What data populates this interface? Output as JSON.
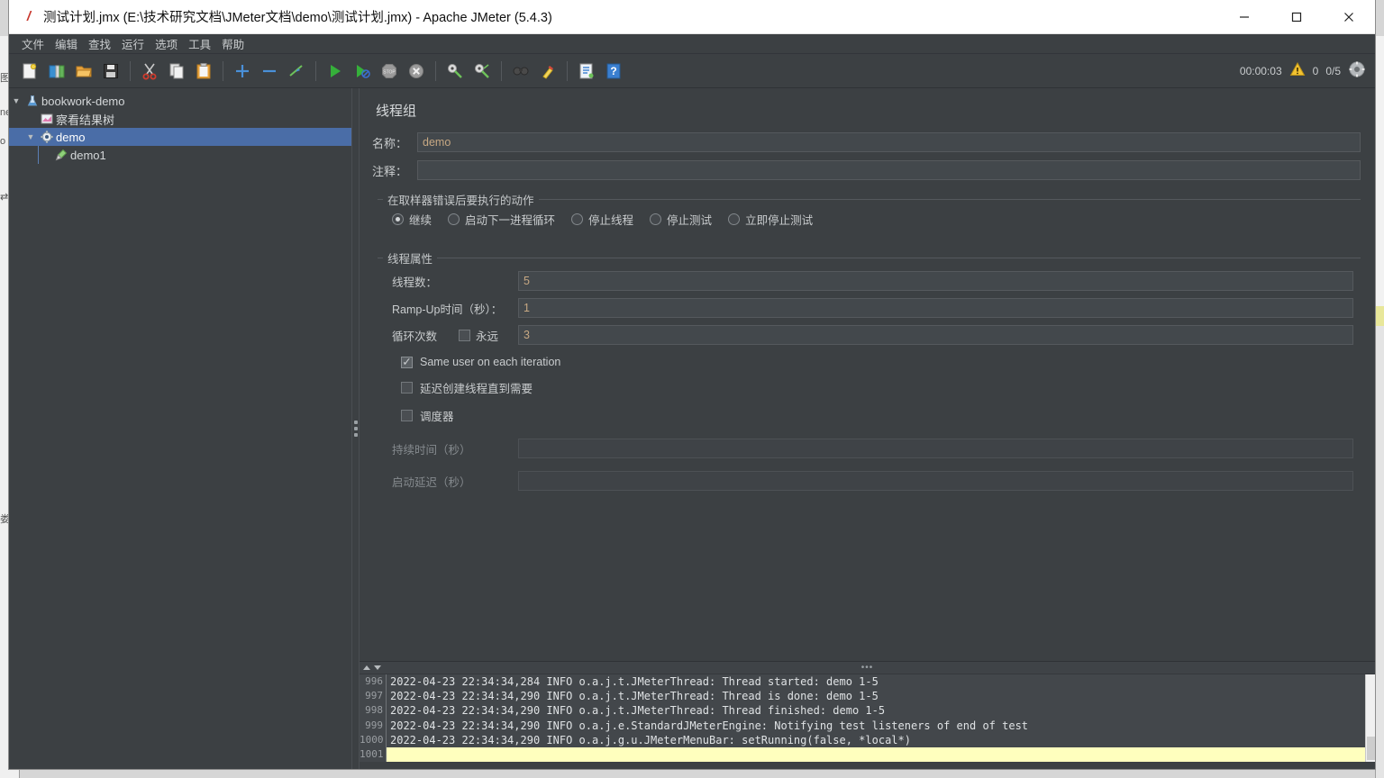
{
  "window": {
    "title": "测试计划.jmx (E:\\技术研究文档\\JMeter文档\\demo\\测试计划.jmx) - Apache JMeter (5.4.3)",
    "app_icon": "jmeter-feather-icon",
    "minimize_label": "—",
    "maximize_label": "□",
    "close_label": "✕"
  },
  "menubar": {
    "items": [
      {
        "label": "文件",
        "name": "menu-file"
      },
      {
        "label": "编辑",
        "name": "menu-edit"
      },
      {
        "label": "查找",
        "name": "menu-search"
      },
      {
        "label": "运行",
        "name": "menu-run"
      },
      {
        "label": "选项",
        "name": "menu-options"
      },
      {
        "label": "工具",
        "name": "menu-tools"
      },
      {
        "label": "帮助",
        "name": "menu-help"
      }
    ]
  },
  "toolbar": {
    "buttons": [
      {
        "name": "new-icon",
        "glyph": "📄"
      },
      {
        "name": "templates-icon",
        "glyph": "📚"
      },
      {
        "name": "open-icon",
        "glyph": "📂"
      },
      {
        "name": "save-icon",
        "glyph": "💾"
      },
      {
        "name": "cut-icon",
        "glyph": "✂"
      },
      {
        "name": "copy-icon",
        "glyph": "📑"
      },
      {
        "name": "paste-icon",
        "glyph": "📋"
      },
      {
        "name": "expand-all-icon",
        "glyph": "+"
      },
      {
        "name": "collapse-all-icon",
        "glyph": "−"
      },
      {
        "name": "toggle-icon",
        "glyph": "⚡"
      },
      {
        "name": "start-icon",
        "glyph": "▶"
      },
      {
        "name": "start-no-pauses-icon",
        "glyph": "▶"
      },
      {
        "name": "stop-icon",
        "glyph": "STOP"
      },
      {
        "name": "shutdown-icon",
        "glyph": "✖"
      },
      {
        "name": "clear-icon",
        "glyph": "🧹"
      },
      {
        "name": "clear-all-icon",
        "glyph": "🧹"
      },
      {
        "name": "search-icon",
        "glyph": "🔍"
      },
      {
        "name": "reset-search-icon",
        "glyph": "🧹"
      },
      {
        "name": "function-helper-icon",
        "glyph": "📝"
      },
      {
        "name": "help-icon",
        "glyph": "?"
      }
    ],
    "status": {
      "elapsed": "00:00:03",
      "warning_icon": "warning-triangle-icon",
      "warning_count": "0",
      "threads": "0/5",
      "activity_icon": "activity-indicator-icon"
    }
  },
  "tree": {
    "nodes": [
      {
        "label": "bookwork-demo",
        "icon": "test-plan-flask-icon",
        "depth": 0,
        "expanded": true,
        "selected": false
      },
      {
        "label": "察看结果树",
        "icon": "view-results-tree-icon",
        "depth": 1,
        "expanded": null,
        "selected": false
      },
      {
        "label": "demo",
        "icon": "thread-group-gear-icon",
        "depth": 1,
        "expanded": true,
        "selected": true
      },
      {
        "label": "demo1",
        "icon": "sampler-pipette-icon",
        "depth": 2,
        "expanded": null,
        "selected": false
      }
    ]
  },
  "main": {
    "panel_title": "线程组",
    "name_label": "名称：",
    "name_value": "demo",
    "comment_label": "注释：",
    "comment_value": "",
    "on_error": {
      "legend": "在取样器错误后要执行的动作",
      "options": [
        {
          "label": "继续",
          "selected": true
        },
        {
          "label": "启动下一进程循环",
          "selected": false
        },
        {
          "label": "停止线程",
          "selected": false
        },
        {
          "label": "停止测试",
          "selected": false
        },
        {
          "label": "立即停止测试",
          "selected": false
        }
      ]
    },
    "thread_props": {
      "legend": "线程属性",
      "num_threads_label": "线程数：",
      "num_threads_value": "5",
      "ramp_up_label": "Ramp-Up时间（秒）：",
      "ramp_up_value": "1",
      "loop_label": "循环次数",
      "forever_label": "永远",
      "forever_checked": false,
      "loop_value": "3",
      "same_user_label": "Same user on each iteration",
      "same_user_checked": true,
      "delayed_start_label": "延迟创建线程直到需要",
      "delayed_start_checked": false,
      "scheduler_label": "调度器",
      "scheduler_checked": false,
      "duration_label": "持续时间（秒）",
      "duration_value": "",
      "startup_delay_label": "启动延迟（秒）",
      "startup_delay_value": ""
    }
  },
  "log": {
    "line_numbers": [
      "996",
      "997",
      "998",
      "999",
      "1000",
      "1001"
    ],
    "lines": [
      "2022-04-23 22:34:34,284 INFO o.a.j.t.JMeterThread: Thread started: demo 1-5",
      "2022-04-23 22:34:34,290 INFO o.a.j.t.JMeterThread: Thread is done: demo 1-5",
      "2022-04-23 22:34:34,290 INFO o.a.j.t.JMeterThread: Thread finished: demo 1-5",
      "2022-04-23 22:34:34,290 INFO o.a.j.e.StandardJMeterEngine: Notifying test listeners of end of test",
      "2022-04-23 22:34:34,290 INFO o.a.j.g.u.JMeterMenuBar: setRunning(false, *local*)",
      ""
    ],
    "scroll_up_icon": "triangle-up-icon",
    "scroll_down_icon": "triangle-down-icon",
    "grip_icon": "drag-grip-icon"
  },
  "colors": {
    "window_bg": "#3c4043",
    "selection": "#4a6da7",
    "input_text": "#c7a883",
    "log_highlight": "#ffffbe"
  }
}
